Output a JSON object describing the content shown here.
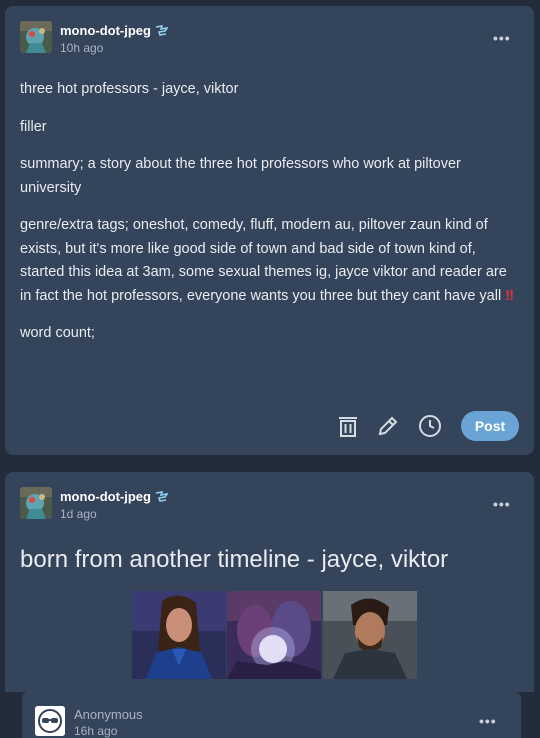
{
  "drafts": [
    {
      "username": "mono-dot-jpeg",
      "timestamp": "10h ago",
      "more_label": "•••",
      "paragraphs": {
        "title": "three hot professors - jayce, viktor",
        "filler": "filler",
        "summary": "summary; a story about the three hot professors who work at piltover university",
        "tags": "genre/extra tags; oneshot, comedy, fluff, modern au, piltover zaun kind of exists, but it's more like good side of town and bad side of town kind of, started this idea at 3am, some sexual themes ig, jayce viktor and reader are in fact the hot professors, everyone wants you three but they cant have yall",
        "tags_emoji": "‼",
        "word_count": "word count;"
      },
      "post_label": "Post",
      "icons": [
        "trash-icon",
        "edit-icon",
        "clock-icon"
      ]
    },
    {
      "username": "mono-dot-jpeg",
      "timestamp": "1d ago",
      "more_label": "•••",
      "title": "born from another timeline - jayce, viktor",
      "images": [
        "portrait-long-hair",
        "embrace-glow",
        "portrait-beard"
      ]
    },
    {
      "username": "Anonymous",
      "timestamp": "16h ago",
      "more_label": "•••"
    }
  ],
  "colors": {
    "background": "#222c3a",
    "card": "#34445a",
    "accent": "#6aa4d6",
    "emoji_red": "#e8333c"
  }
}
